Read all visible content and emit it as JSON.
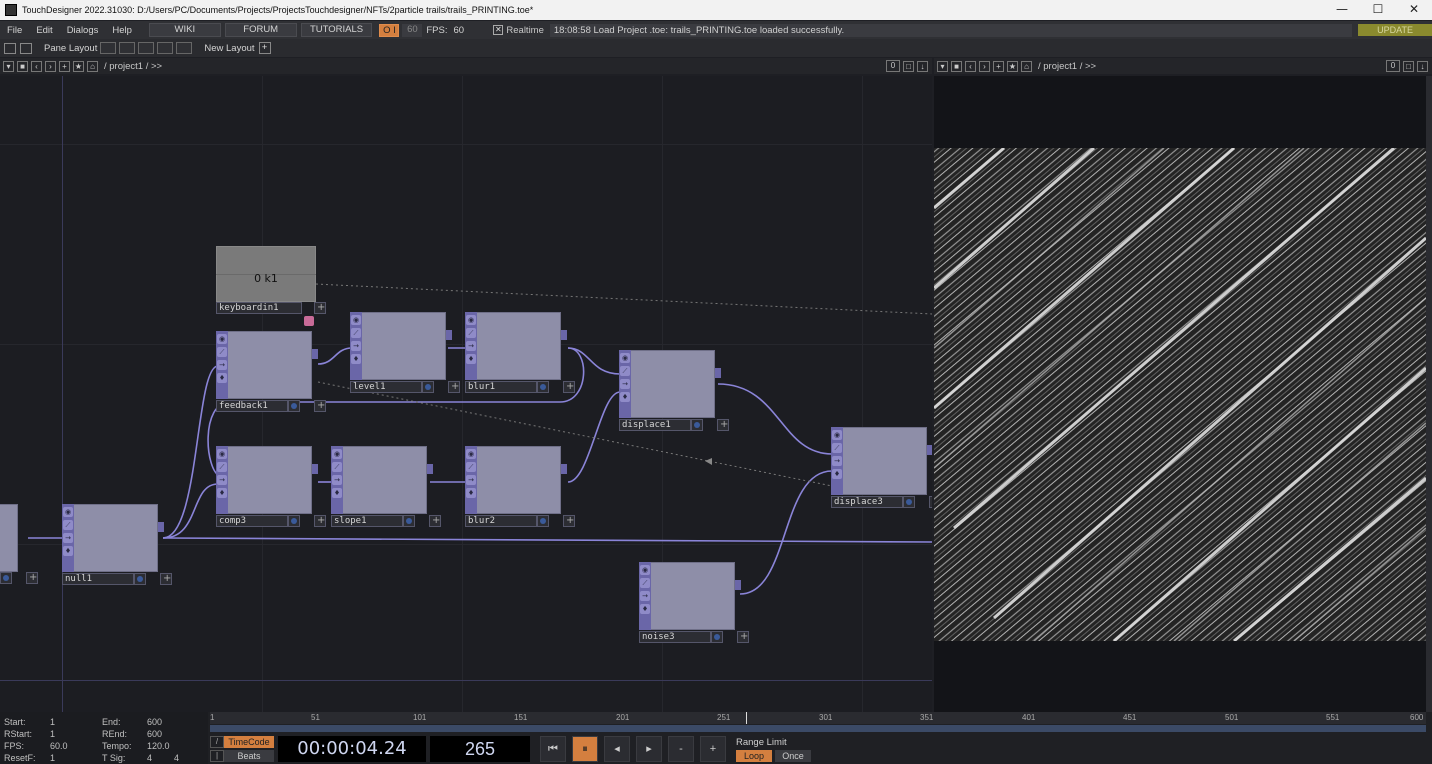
{
  "window": {
    "title": "TouchDesigner 2022.31030: D:/Users/PC/Documents/Projects/ProjectsTouchdesigner/NFTs/2particle trails/trails_PRINTING.toe*",
    "minimize": "—",
    "maximize": "☐",
    "close": "✕"
  },
  "menu": {
    "items": [
      "File",
      "Edit",
      "Dialogs",
      "Help"
    ],
    "wiki": "WIKI",
    "forum": "FORUM",
    "tutorials": "TUTORIALS",
    "oi": "O I",
    "fps_cap": "60",
    "fps_label": "FPS:",
    "fps_value": "60",
    "realtime_label": "Realtime",
    "realtime_checked": "✕",
    "status": "18:08:58 Load Project .toe: trails_PRINTING.toe loaded successfully.",
    "update": "UPDATE"
  },
  "toolbar": {
    "pane_layout": "Pane Layout",
    "new_layout": "New Layout",
    "plus": "+"
  },
  "left_path": {
    "path": "/ project1 / >>",
    "num": "0"
  },
  "right_path": {
    "path": "/ project1 / >>",
    "num": "0"
  },
  "nodes": {
    "keyboardin": {
      "label": "keyboardin1",
      "text": "0 k1"
    },
    "feedback": "feedback1",
    "level": "level1",
    "blur1": "blur1",
    "displace1": "displace1",
    "displace3": "displace3",
    "comp3": "comp3",
    "slope1": "slope1",
    "blur2": "blur2",
    "null1": "null1",
    "noise3": "noise3"
  },
  "info": {
    "start_l": "Start:",
    "start_v": "1",
    "end_l": "End:",
    "end_v": "600",
    "rstart_l": "RStart:",
    "rstart_v": "1",
    "rend_l": "REnd:",
    "rend_v": "600",
    "fps_l": "FPS:",
    "fps_v": "60.0",
    "tempo_l": "Tempo:",
    "tempo_v": "120.0",
    "resetf_l": "ResetF:",
    "resetf_v": "1",
    "tsig_l": "T Sig:",
    "tsig_v1": "4",
    "tsig_v2": "4"
  },
  "ruler": [
    "1",
    "51",
    "101",
    "151",
    "201",
    "251",
    "301",
    "351",
    "401",
    "451",
    "501",
    "551",
    "600"
  ],
  "transport": {
    "timecode": "TimeCode",
    "beats": "Beats",
    "time": "00:00:04.24",
    "frame": "265",
    "range_limit": "Range Limit",
    "loop": "Loop",
    "once": "Once",
    "minus": "-",
    "plus": "+"
  },
  "colors": {
    "accent": "#d47f3f",
    "wire": "#8a84d8",
    "top_node": "#6a66a8"
  }
}
